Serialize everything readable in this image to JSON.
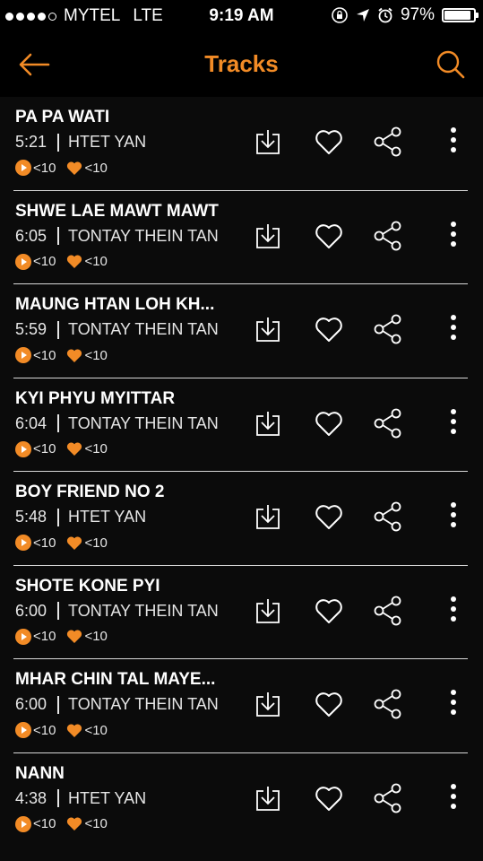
{
  "status_bar": {
    "carrier": "MYTEL",
    "network": "LTE",
    "time": "9:19 AM",
    "battery": "97%",
    "battery_level": 0.97
  },
  "header": {
    "title": "Tracks",
    "back_icon": "arrow-left-icon",
    "search_icon": "search-icon"
  },
  "colors": {
    "accent": "#f28b26",
    "background": "#0b0b0b"
  },
  "tracks": [
    {
      "title": "PA PA WATI",
      "duration": "5:21",
      "artist": "HTET YAN",
      "plays": "<10",
      "likes": "<10"
    },
    {
      "title": "SHWE LAE MAWT MAWT",
      "duration": "6:05",
      "artist": "TONTAY THEIN TAN",
      "plays": "<10",
      "likes": "<10"
    },
    {
      "title": "MAUNG HTAN LOH KH...",
      "duration": "5:59",
      "artist": "TONTAY THEIN TAN",
      "plays": "<10",
      "likes": "<10"
    },
    {
      "title": "KYI PHYU MYITTAR",
      "duration": "6:04",
      "artist": "TONTAY THEIN TAN",
      "plays": "<10",
      "likes": "<10"
    },
    {
      "title": "BOY FRIEND NO 2",
      "duration": "5:48",
      "artist": "HTET YAN",
      "plays": "<10",
      "likes": "<10"
    },
    {
      "title": "SHOTE KONE PYI",
      "duration": "6:00",
      "artist": "TONTAY THEIN TAN",
      "plays": "<10",
      "likes": "<10"
    },
    {
      "title": "MHAR CHIN TAL MAYE...",
      "duration": "6:00",
      "artist": "TONTAY THEIN TAN",
      "plays": "<10",
      "likes": "<10"
    },
    {
      "title": "NANN",
      "duration": "4:38",
      "artist": "HTET YAN",
      "plays": "<10",
      "likes": "<10"
    }
  ]
}
